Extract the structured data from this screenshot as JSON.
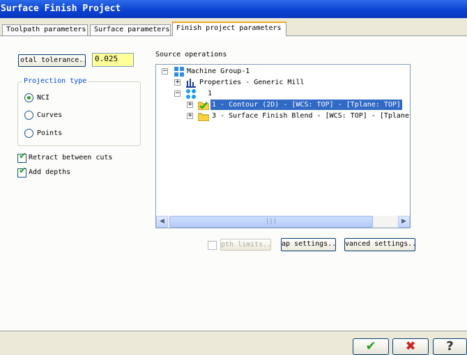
{
  "window": {
    "title": "Surface Finish Project"
  },
  "tabs": [
    {
      "label": "Toolpath parameters"
    },
    {
      "label": "Surface parameters"
    },
    {
      "label": "Finish project parameters"
    }
  ],
  "tolerance": {
    "button_label": "otal tolerance..",
    "value": "0.025"
  },
  "projection": {
    "title": "Projection type",
    "options": [
      {
        "label": "NCI",
        "selected": true
      },
      {
        "label": "Curves",
        "selected": false
      },
      {
        "label": "Points",
        "selected": false
      }
    ]
  },
  "options": {
    "retract_label": "Retract between cuts",
    "add_depths_label": "Add depths"
  },
  "source_ops": {
    "label": "Source operations",
    "tree": {
      "machine_group": "Machine Group-1",
      "properties": "Properties - Generic Mill",
      "group_number": "1",
      "op1": "1 - Contour (2D) - [WCS: TOP] - [Tplane: TOP]",
      "op3": "3 - Surface Finish Blend - [WCS: TOP] - [Tplane"
    },
    "scroll_thumb_glyph": "|||"
  },
  "bottom_buttons": {
    "depth_limits": "pth limits..",
    "gap_settings": "ap settings..",
    "advanced_settings": "vanced settings.."
  },
  "footer": {
    "ok_glyph": "✔",
    "cancel_glyph": "✖",
    "help_glyph": "?"
  },
  "colors": {
    "titlebar": "#0a3fd1",
    "input_bg": "#ffff99",
    "selection": "#316ac5",
    "ok_green": "#21a121",
    "cancel_red": "#d12020"
  }
}
